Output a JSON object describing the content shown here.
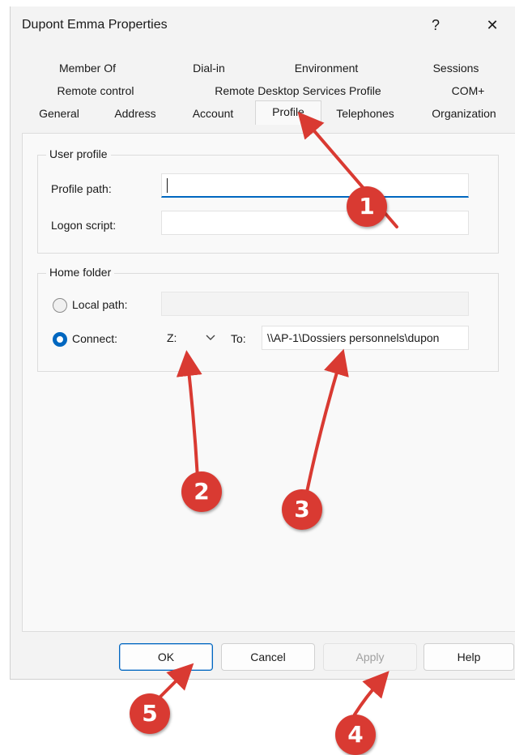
{
  "window": {
    "title": "Dupont Emma Properties",
    "help_button": "?",
    "close_button": "✕"
  },
  "tabs": {
    "row1": [
      "Member Of",
      "Dial-in",
      "Environment",
      "Sessions"
    ],
    "row2": [
      "Remote control",
      "Remote Desktop Services Profile",
      "COM+"
    ],
    "row3": [
      "General",
      "Address",
      "Account",
      "Profile",
      "Telephones",
      "Organization"
    ],
    "selected": "Profile"
  },
  "user_profile": {
    "title": "User profile",
    "profile_path_label": "Profile path:",
    "profile_path_value": "",
    "logon_script_label": "Logon script:",
    "logon_script_value": ""
  },
  "home_folder": {
    "title": "Home folder",
    "local_path_label": "Local path:",
    "local_path_value": "",
    "connect_label": "Connect:",
    "drive_value": "Z:",
    "to_label": "To:",
    "to_value": "\\\\AP-1\\Dossiers personnels\\dupon",
    "selected_option": "Connect"
  },
  "buttons": {
    "ok": "OK",
    "cancel": "Cancel",
    "apply": "Apply",
    "help": "Help"
  },
  "annotations": {
    "color": "#d93a32",
    "badges": [
      "1",
      "2",
      "3",
      "4",
      "5"
    ]
  },
  "colors": {
    "accent": "#0067c0",
    "panel": "#f9f9f9",
    "window": "#f3f3f3"
  }
}
